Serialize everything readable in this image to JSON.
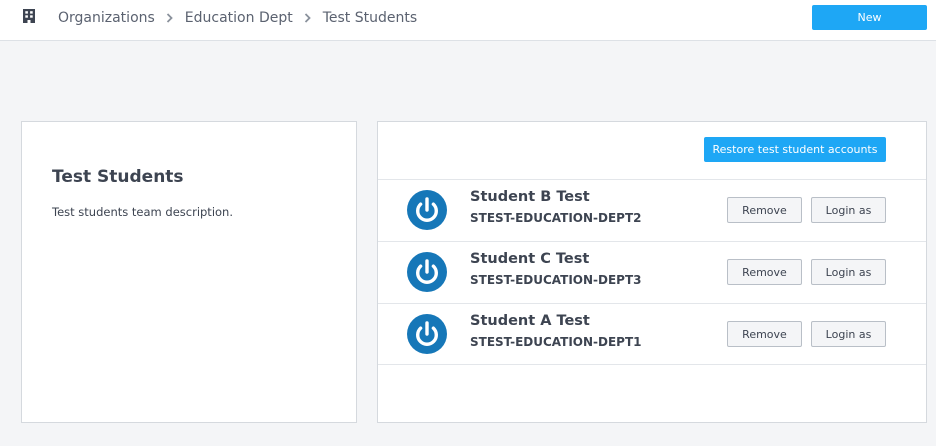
{
  "header": {
    "org_icon": "building-icon",
    "breadcrumbs": [
      "Organizations",
      "Education Dept",
      "Test Students"
    ],
    "new_label": "New"
  },
  "team": {
    "title": "Test Students",
    "description": "Test students team description."
  },
  "members_panel": {
    "restore_label": "Restore test student accounts",
    "remove_label": "Remove",
    "login_label": "Login as",
    "avatar_icon": "power-icon",
    "avatar_color": "#1677b8",
    "students": [
      {
        "name": "Student B Test",
        "id": "STEST-EDUCATION-DEPT2"
      },
      {
        "name": "Student C Test",
        "id": "STEST-EDUCATION-DEPT3"
      },
      {
        "name": "Student A Test",
        "id": "STEST-EDUCATION-DEPT1"
      }
    ]
  },
  "colors": {
    "accent": "#1ea7f5",
    "page_bg": "#f4f5f7"
  }
}
